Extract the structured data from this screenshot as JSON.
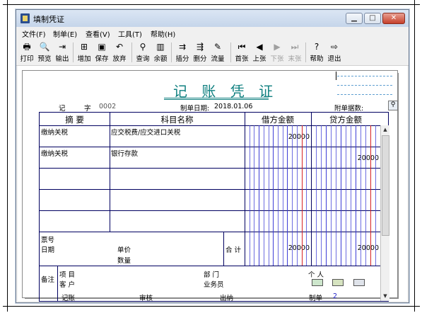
{
  "window": {
    "title": "填制凭证",
    "min": "▭",
    "max": "▭",
    "close": "✕"
  },
  "menu": [
    {
      "label": "文件(F)"
    },
    {
      "label": "制单(E)"
    },
    {
      "label": "查看(V)"
    },
    {
      "label": "工具(T)"
    },
    {
      "label": "帮助(H)"
    }
  ],
  "toolbar": [
    {
      "label": "打印",
      "icon": "printer-icon",
      "glyph": "🖶",
      "enabled": true
    },
    {
      "label": "预览",
      "icon": "preview-icon",
      "glyph": "🔍",
      "enabled": true
    },
    {
      "label": "输出",
      "icon": "export-icon",
      "glyph": "⇥",
      "enabled": true
    },
    {
      "label": "增加",
      "icon": "add-icon",
      "glyph": "⊞",
      "enabled": true
    },
    {
      "label": "保存",
      "icon": "save-icon",
      "glyph": "▣",
      "enabled": true
    },
    {
      "label": "放弃",
      "icon": "undo-icon",
      "glyph": "↶",
      "enabled": true
    },
    {
      "label": "查询",
      "icon": "binoculars-icon",
      "glyph": "⚲",
      "enabled": true
    },
    {
      "label": "余额",
      "icon": "bar-chart-icon",
      "glyph": "▥",
      "enabled": true
    },
    {
      "label": "插分",
      "icon": "insert-row-icon",
      "glyph": "⇉",
      "enabled": true
    },
    {
      "label": "删分",
      "icon": "delete-row-icon",
      "glyph": "⇶",
      "enabled": true
    },
    {
      "label": "流量",
      "icon": "flow-icon",
      "glyph": "✎",
      "enabled": true
    },
    {
      "label": "首张",
      "icon": "first-icon",
      "glyph": "⏮",
      "enabled": true
    },
    {
      "label": "上张",
      "icon": "prev-icon",
      "glyph": "◀",
      "enabled": true
    },
    {
      "label": "下张",
      "icon": "next-icon",
      "glyph": "▶",
      "enabled": false
    },
    {
      "label": "末张",
      "icon": "last-icon",
      "glyph": "⏭",
      "enabled": false
    },
    {
      "label": "帮助",
      "icon": "help-icon",
      "glyph": "?",
      "enabled": true
    },
    {
      "label": "退出",
      "icon": "exit-icon",
      "glyph": "⇨",
      "enabled": true
    }
  ],
  "voucher": {
    "title": "记 账 凭 证",
    "type_label": "记",
    "zi_label": "字",
    "number": "0002",
    "date_label": "制单日期:",
    "date": "2018.01.06",
    "attach_label": "附单据数:",
    "headers": {
      "summary": "摘 要",
      "account": "科目名称",
      "debit": "借方金额",
      "credit": "贷方金额"
    },
    "rows": [
      {
        "summary": "缴纳关税",
        "account": "应交税费/应交进口关税",
        "debit": "20000",
        "credit": ""
      },
      {
        "summary": "缴纳关税",
        "account": "银行存款",
        "debit": "",
        "credit": "20000"
      },
      {
        "summary": "",
        "account": "",
        "debit": "",
        "credit": ""
      },
      {
        "summary": "",
        "account": "",
        "debit": "",
        "credit": ""
      },
      {
        "summary": "",
        "account": "",
        "debit": "",
        "credit": ""
      }
    ],
    "ticket_label": "票号",
    "date_row_label": "日期",
    "unit_price_label": "单价",
    "quantity_label": "数量",
    "total_label": "合 计",
    "total_debit": "20000",
    "total_credit": "20000",
    "remarks_label": "备注",
    "project_label": "项 目",
    "customer_label": "客 户",
    "dept_label": "部 门",
    "salesperson_label": "业务员",
    "person_label": "个 人",
    "bookkeeping_label": "记账",
    "review_label": "审核",
    "cashier_label": "出纳",
    "maker_label": "制单",
    "maker_value": "2"
  },
  "colors": {
    "title": "#0e7f7f",
    "grid": "#000060",
    "digit_blue": "#3b3bd6",
    "digit_red": "#d62020"
  }
}
